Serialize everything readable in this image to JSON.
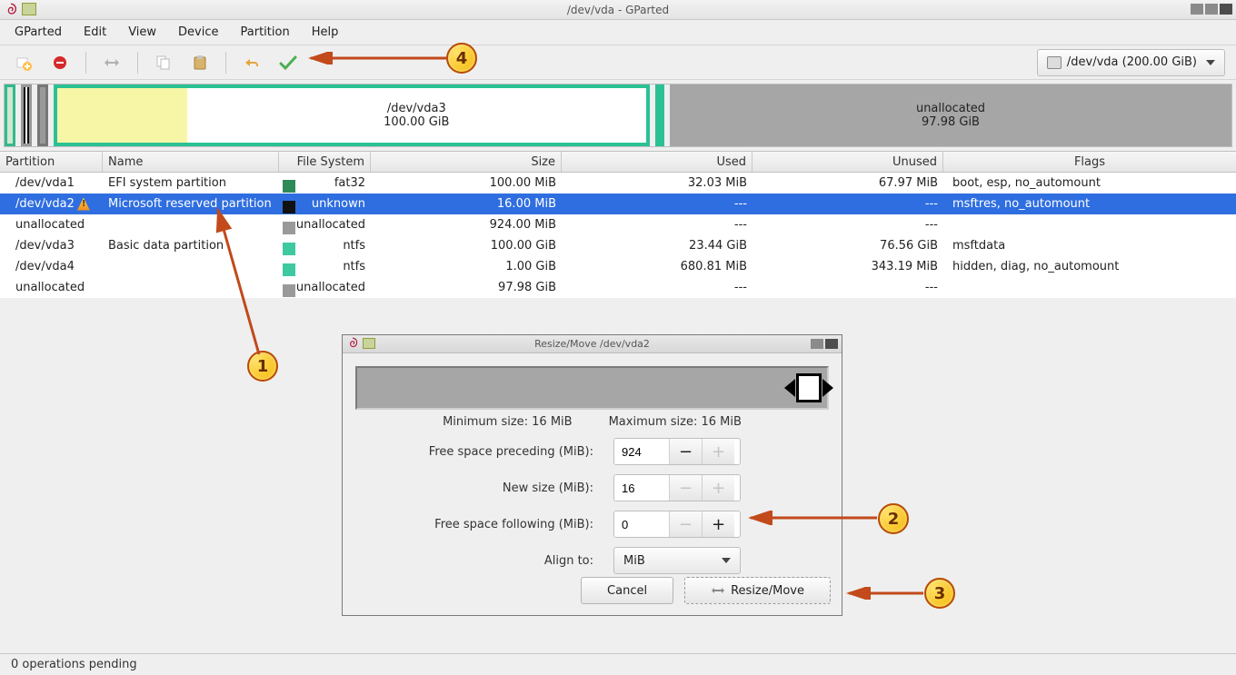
{
  "window": {
    "title": "/dev/vda - GParted"
  },
  "menubar": [
    "GParted",
    "Edit",
    "View",
    "Device",
    "Partition",
    "Help"
  ],
  "device_selector": "/dev/vda  (200.00 GiB)",
  "graphic": {
    "main_label": "/dev/vda3",
    "main_size": "100.00 GiB",
    "unalloc_label": "unallocated",
    "unalloc_size": "97.98 GiB"
  },
  "columns": {
    "partition": "Partition",
    "name": "Name",
    "fs": "File System",
    "size": "Size",
    "used": "Used",
    "unused": "Unused",
    "flags": "Flags"
  },
  "rows": [
    {
      "partition": "/dev/vda1",
      "warn": false,
      "name": "EFI system partition",
      "fs": "fat32",
      "fsClass": "fat32",
      "size": "100.00 MiB",
      "used": "32.03 MiB",
      "unused": "67.97 MiB",
      "flags": "boot, esp, no_automount",
      "selected": false
    },
    {
      "partition": "/dev/vda2",
      "warn": true,
      "name": "Microsoft reserved partition",
      "fs": "unknown",
      "fsClass": "unknown",
      "size": "16.00 MiB",
      "used": "---",
      "unused": "---",
      "flags": "msftres, no_automount",
      "selected": true
    },
    {
      "partition": "unallocated",
      "warn": false,
      "name": "",
      "fs": "unallocated",
      "fsClass": "unalloc",
      "size": "924.00 MiB",
      "used": "---",
      "unused": "---",
      "flags": "",
      "selected": false
    },
    {
      "partition": "/dev/vda3",
      "warn": false,
      "name": "Basic data partition",
      "fs": "ntfs",
      "fsClass": "ntfs",
      "size": "100.00 GiB",
      "used": "23.44 GiB",
      "unused": "76.56 GiB",
      "flags": "msftdata",
      "selected": false
    },
    {
      "partition": "/dev/vda4",
      "warn": false,
      "name": "",
      "fs": "ntfs",
      "fsClass": "ntfs",
      "size": "1.00 GiB",
      "used": "680.81 MiB",
      "unused": "343.19 MiB",
      "flags": "hidden, diag, no_automount",
      "selected": false
    },
    {
      "partition": "unallocated",
      "warn": false,
      "name": "",
      "fs": "unallocated",
      "fsClass": "unalloc",
      "size": "97.98 GiB",
      "used": "---",
      "unused": "---",
      "flags": "",
      "selected": false
    }
  ],
  "statusbar": "0 operations pending",
  "dialog": {
    "title": "Resize/Move /dev/vda2",
    "min": "Minimum size: 16 MiB",
    "max": "Maximum size: 16 MiB",
    "labels": {
      "preceding": "Free space preceding (MiB):",
      "newsize": "New size (MiB):",
      "following": "Free space following (MiB):",
      "align": "Align to:"
    },
    "values": {
      "preceding": "924",
      "newsize": "16",
      "following": "0",
      "align": "MiB"
    },
    "buttons": {
      "cancel": "Cancel",
      "resize": "Resize/Move"
    }
  },
  "badges": {
    "b1": "1",
    "b2": "2",
    "b3": "3",
    "b4": "4"
  }
}
